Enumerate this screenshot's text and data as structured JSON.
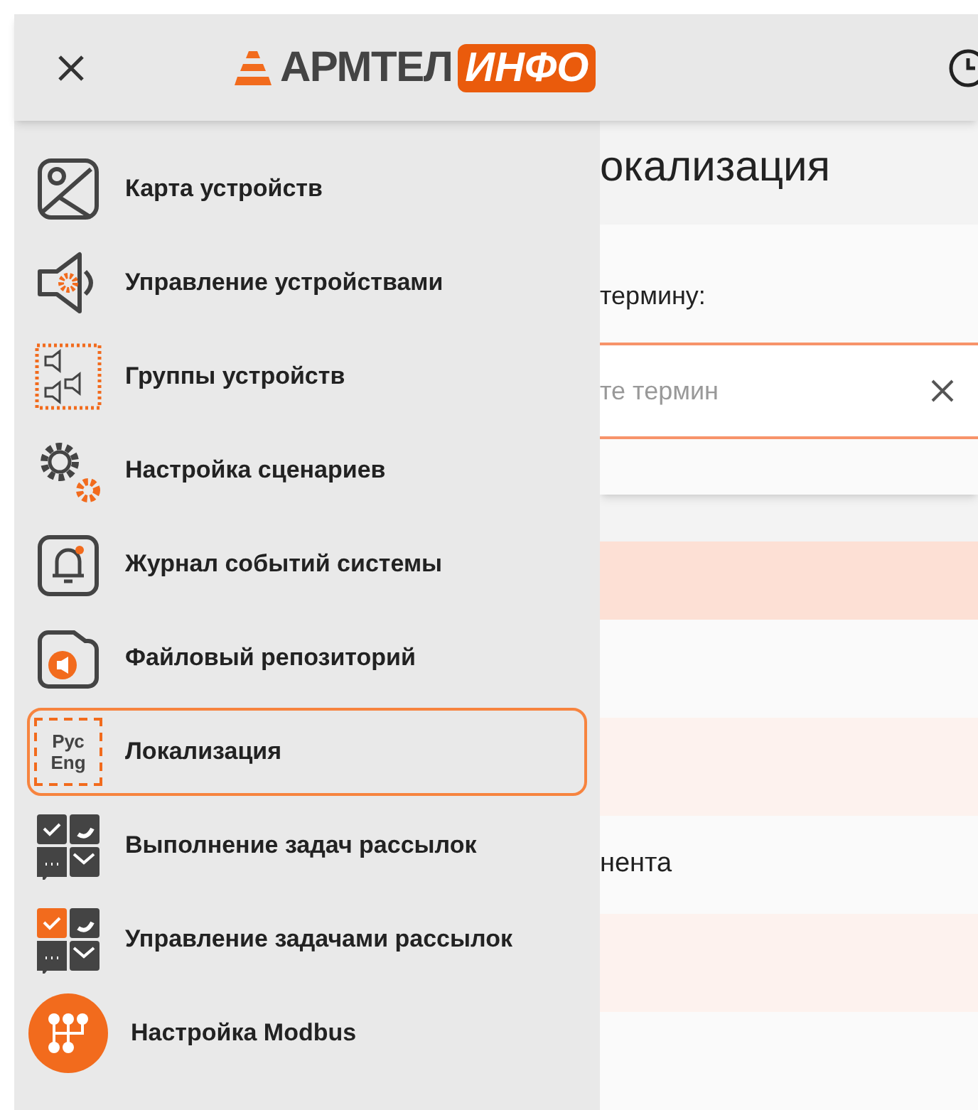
{
  "header": {
    "logo_text": "АРМТЕЛ",
    "logo_badge": "ИНФО"
  },
  "menu": [
    {
      "label": "Карта устройств",
      "selected": false
    },
    {
      "label": "Управление устройствами",
      "selected": false
    },
    {
      "label": "Группы устройств",
      "selected": false
    },
    {
      "label": "Настройка сценариев",
      "selected": false
    },
    {
      "label": "Журнал событий системы",
      "selected": false
    },
    {
      "label": "Файловый репозиторий",
      "selected": false
    },
    {
      "label": "Локализация",
      "selected": true,
      "icon_text": [
        "Рус",
        "Eng"
      ]
    },
    {
      "label": "Выполнение задач рассылок",
      "selected": false
    },
    {
      "label": "Управление задачами рассылок",
      "selected": false
    },
    {
      "label": "Настройка Modbus",
      "selected": false
    }
  ],
  "page": {
    "title": "окализация",
    "filter_label": "термину:",
    "search": {
      "placeholder": "те термин"
    },
    "table": {
      "rows": [
        {
          "kind": "header",
          "text": ""
        },
        {
          "kind": "row",
          "text": ""
        },
        {
          "kind": "row",
          "text": ""
        },
        {
          "kind": "row",
          "text": "нента"
        },
        {
          "kind": "row",
          "text": ""
        },
        {
          "kind": "row",
          "text": ""
        }
      ]
    }
  }
}
